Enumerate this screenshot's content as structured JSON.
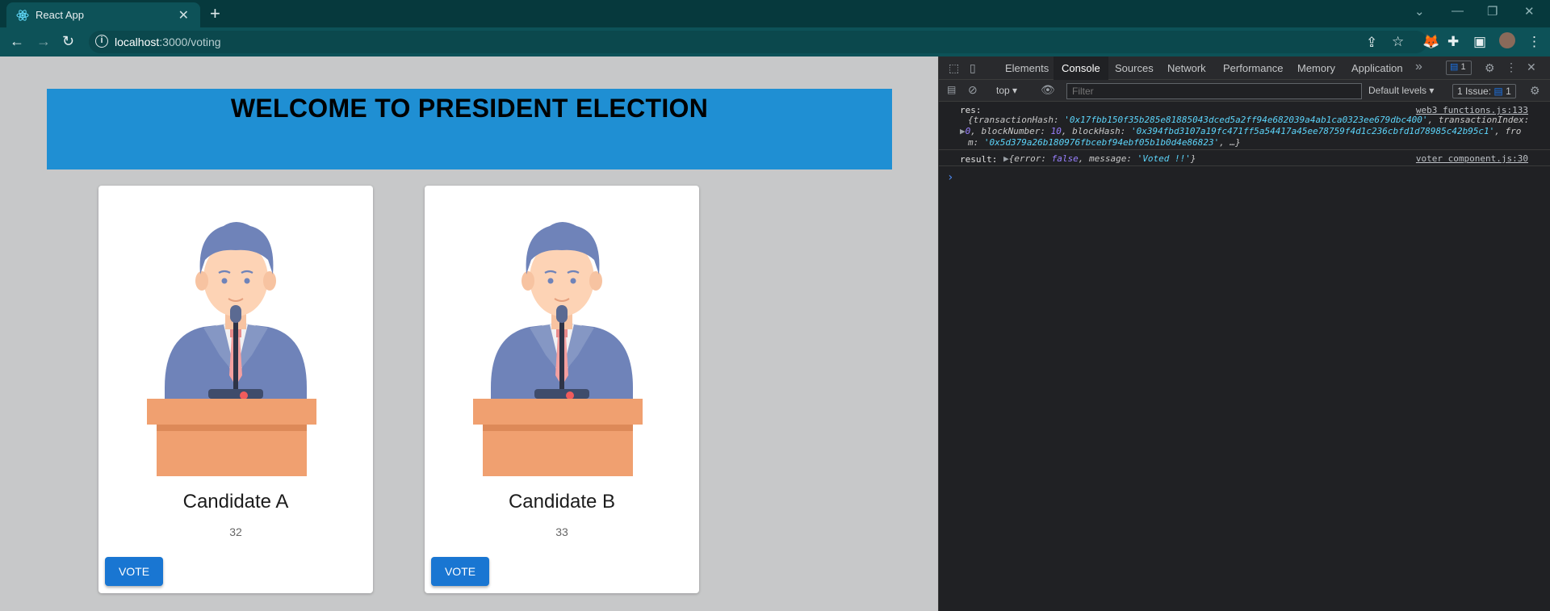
{
  "browser": {
    "tab_title": "React App",
    "tab_close": "✕",
    "new_tab": "+",
    "url_host": "localhost",
    "url_rest": ":3000/voting"
  },
  "page": {
    "heading": "WELCOME TO PRESIDENT ELECTION",
    "candidates": [
      {
        "name": "Candidate A",
        "votes": "32",
        "button": "VOTE"
      },
      {
        "name": "Candidate B",
        "votes": "33",
        "button": "VOTE"
      }
    ]
  },
  "devtools": {
    "tabs": [
      "Elements",
      "Console",
      "Sources",
      "Network",
      "Performance",
      "Memory",
      "Application"
    ],
    "active_tab": "Console",
    "more": "»",
    "message_badge": "1",
    "context": "top",
    "filter_placeholder": "Filter",
    "levels": "Default levels",
    "issues_label": "1 Issue:",
    "issues_count": "1",
    "log1": {
      "label": "res:",
      "source": "web3 functions.js:133",
      "line1_key1": "transactionHash",
      "line1_val1": "'0x17fbb150f35b285e81885043dced5a2ff94e682039a4ab1ca0323ee679dbc400'",
      "line1_key2": "transactionIndex:",
      "line2_val0": "0",
      "line2_key1": "blockNumber",
      "line2_val1": "10",
      "line2_key2": "blockHash",
      "line2_val2": "'0x394fbd3107a19fc471ff5a54417a45ee78759f4d1c236cbfd1d78985c42b95c1'",
      "line2_tail": ", fro",
      "line3_head": "m:",
      "line3_val": "'0x5d379a26b180976fbcebf94ebf05b1b0d4e86823'",
      "line3_tail": ", …}"
    },
    "log2": {
      "label": "result:",
      "source": "voter component.js:30",
      "key1": "error",
      "val1": "false",
      "key2": "message",
      "val2": "'Voted !!'"
    },
    "prompt": "›"
  },
  "colors": {
    "banner": "#1f8fd3",
    "vote_button": "#1976d2",
    "chrome_tabbar": "#06393d",
    "chrome_toolbar": "#0d5258"
  }
}
